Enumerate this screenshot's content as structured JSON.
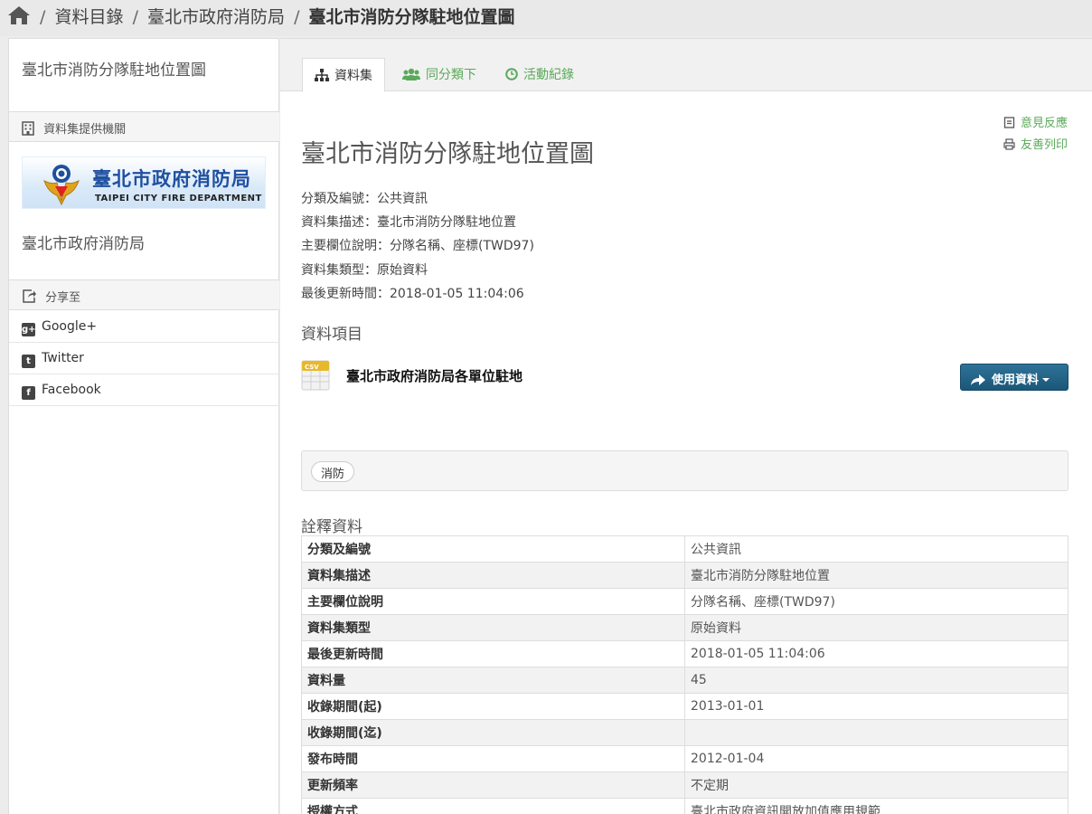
{
  "breadcrumb": {
    "home_icon": "home-icon",
    "items": [
      "資料目錄",
      "臺北市政府消防局"
    ],
    "current": "臺北市消防分隊駐地位置圖"
  },
  "sidebar": {
    "title": "臺北市消防分隊駐地位置圖",
    "provider_heading": "資料集提供機關",
    "logo": {
      "text_zh": "臺北市政府消防局",
      "text_en": "TAIPEI CITY FIRE DEPARTMENT"
    },
    "org_name": "臺北市政府消防局",
    "share_heading": "分享至",
    "share_items": [
      {
        "icon": "google-plus-icon",
        "label": "Google+"
      },
      {
        "icon": "twitter-icon",
        "label": "Twitter"
      },
      {
        "icon": "facebook-icon",
        "label": "Facebook"
      }
    ]
  },
  "tabs": [
    {
      "icon": "sitemap-icon",
      "label": "資料集"
    },
    {
      "icon": "users-icon",
      "label": "同分類下"
    },
    {
      "icon": "clock-icon",
      "label": "活動紀錄"
    }
  ],
  "actions": {
    "feedback": "意見反應",
    "print": "友善列印"
  },
  "dataset": {
    "title": "臺北市消防分隊駐地位置圖",
    "meta_lines": [
      "分類及編號：公共資訊",
      "資料集描述：臺北市消防分隊駐地位置",
      "主要欄位說明：分隊名稱、座標(TWD97)",
      "資料集類型：原始資料",
      "最後更新時間：2018-01-05 11:04:06"
    ]
  },
  "resources": {
    "heading": "資料項目",
    "items": [
      {
        "format": "CSV",
        "name": "臺北市政府消防局各單位駐地",
        "button": "使用資料"
      }
    ]
  },
  "tags": [
    "消防"
  ],
  "metadata": {
    "heading": "詮釋資料",
    "rows": [
      {
        "key": "分類及編號",
        "value": "公共資訊"
      },
      {
        "key": "資料集描述",
        "value": "臺北市消防分隊駐地位置"
      },
      {
        "key": "主要欄位說明",
        "value": "分隊名稱、座標(TWD97)"
      },
      {
        "key": "資料集類型",
        "value": "原始資料"
      },
      {
        "key": "最後更新時間",
        "value": "2018-01-05 11:04:06"
      },
      {
        "key": "資料量",
        "value": "45"
      },
      {
        "key": "收錄期間(起)",
        "value": "2013-01-01"
      },
      {
        "key": "收錄期間(迄)",
        "value": ""
      },
      {
        "key": "發布時間",
        "value": "2012-01-04"
      },
      {
        "key": "更新頻率",
        "value": "不定期"
      },
      {
        "key": "授權方式",
        "value": "臺北市政府資訊開放加值應用規範"
      }
    ]
  },
  "colors": {
    "accent_green": "#5aa95a",
    "button_blue": "#1f5f80",
    "logo_blue": "#1f4fa0"
  }
}
